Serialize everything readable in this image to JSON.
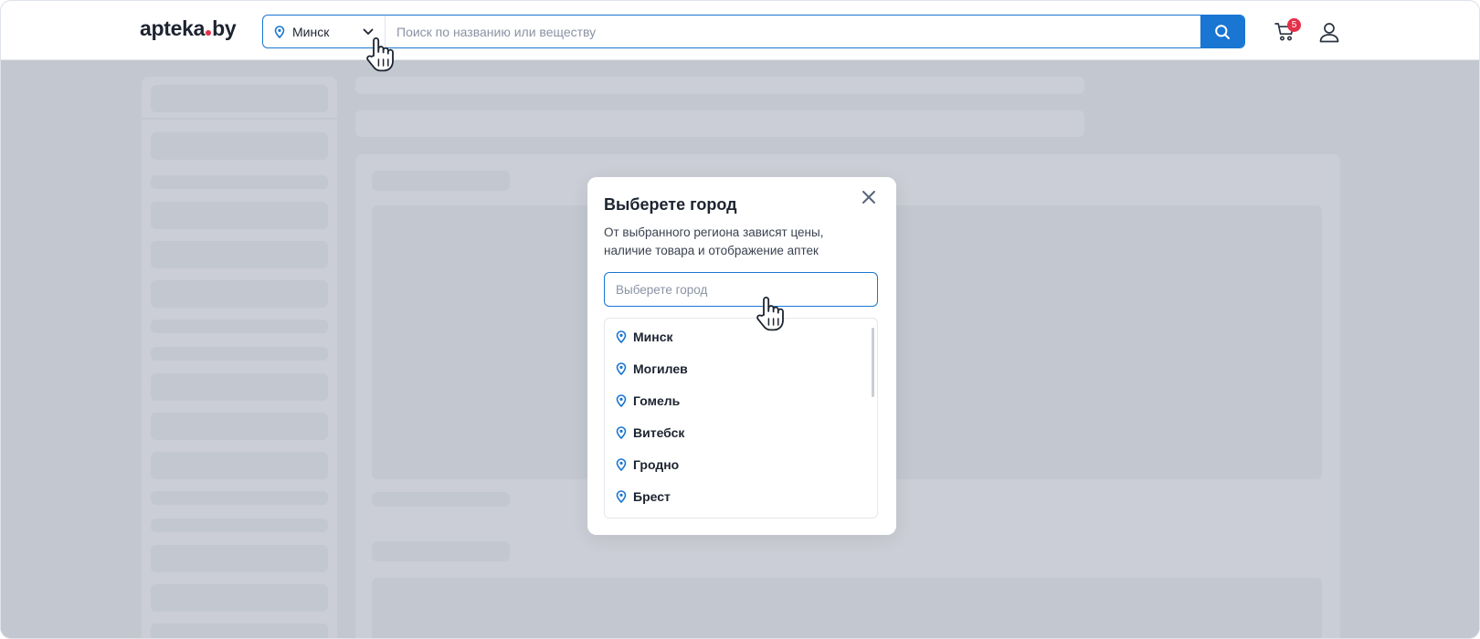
{
  "header": {
    "logo_main": "apteka",
    "logo_tld": "by",
    "city_selected": "Минск",
    "search_placeholder": "Поиск по названию или веществу",
    "cart_count": "5"
  },
  "modal": {
    "title": "Выберете город",
    "description": "От выбранного региона зависят цены, наличие товара и отображение аптек",
    "input_placeholder": "Выберете город",
    "cities": [
      {
        "label": "Минск"
      },
      {
        "label": "Могилев"
      },
      {
        "label": "Гомель"
      },
      {
        "label": "Витебск"
      },
      {
        "label": "Гродно"
      },
      {
        "label": "Брест"
      }
    ]
  },
  "colors": {
    "accent": "#1976d2",
    "badge": "#e5304a",
    "overlay": "#c3c7d0"
  },
  "icons": [
    "location-pin-icon",
    "chevron-down-icon",
    "search-icon",
    "cart-icon",
    "user-icon",
    "close-icon",
    "hand-cursor-icon"
  ]
}
